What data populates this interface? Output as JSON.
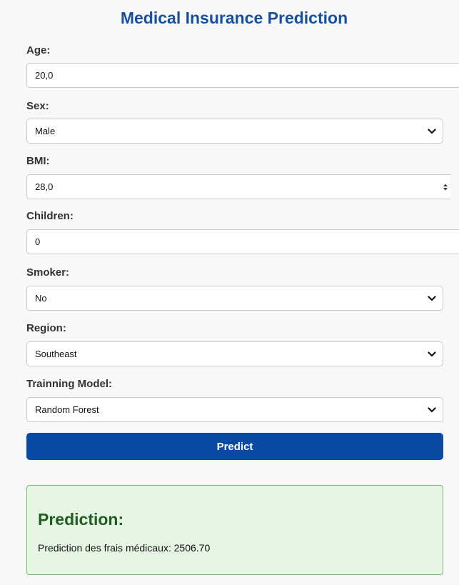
{
  "header": {
    "title": "Medical Insurance Prediction"
  },
  "form": {
    "age": {
      "label": "Age:",
      "value": "20,0"
    },
    "sex": {
      "label": "Sex:",
      "value": "Male"
    },
    "bmi": {
      "label": "BMI:",
      "value": "28,0"
    },
    "children": {
      "label": "Children:",
      "value": "0"
    },
    "smoker": {
      "label": "Smoker:",
      "value": "No"
    },
    "region": {
      "label": "Region:",
      "value": "Southeast"
    },
    "model": {
      "label": "Trainning Model:",
      "value": "Random Forest"
    },
    "submit_label": "Predict"
  },
  "result": {
    "title": "Prediction:",
    "text": "Prediction des frais médicaux: 2506.70"
  },
  "colors": {
    "title": "#1a4f9c",
    "button": "#0b4aa2",
    "result_bg": "#e6f5e4",
    "result_border": "#6fbf70",
    "result_title": "#1e5e20"
  },
  "icons": {
    "select_arrow": "chevron-down-icon",
    "number_spinner": "spinner-arrows-icon"
  }
}
